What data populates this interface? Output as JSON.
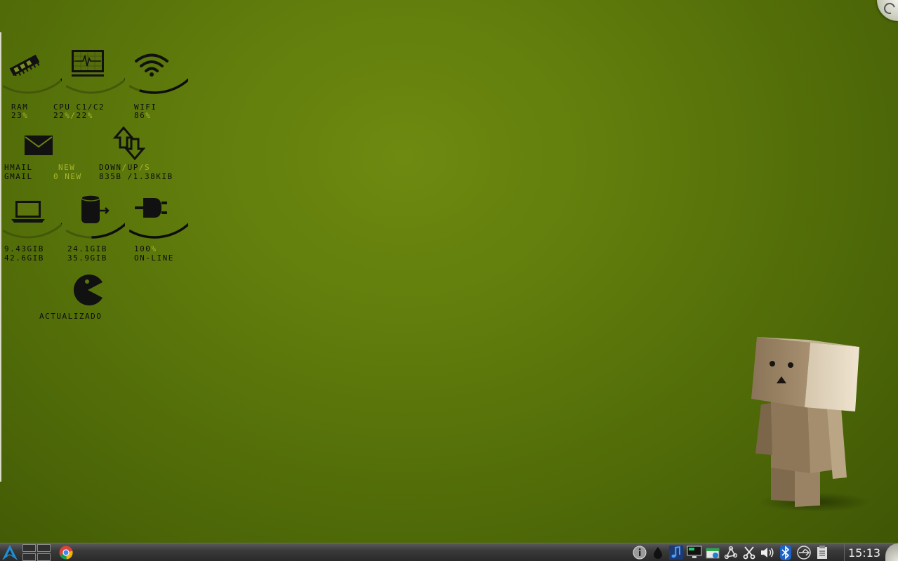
{
  "widgets": {
    "ram": {
      "label": "RAM",
      "value": "23",
      "unit": "%",
      "level": 0.23
    },
    "cpu": {
      "label": "CPU C1/C2",
      "v1": "22",
      "unit1": "%",
      "sep": "/",
      "v2": "22",
      "unit2": "%",
      "level": 0.22
    },
    "wifi": {
      "label": "WIFI",
      "value": "86",
      "unit": "%",
      "level": 0.86
    },
    "mail": {
      "row1_name": "HMAIL",
      "row1_status": "NEW",
      "row2_name": "GMAIL",
      "row2_status": "0 NEW"
    },
    "net": {
      "label_down": "DOWN",
      "sep": "/",
      "label_up": "UP",
      "label_unit": "/S",
      "down": "835B",
      "up": "/1.38KIB"
    },
    "disk1": {
      "used": "9.43GIB",
      "total": "42.6GIB",
      "level": 0.22
    },
    "disk2": {
      "used": "24.1GIB",
      "total": "35.9GIB",
      "level": 0.67
    },
    "power": {
      "value": "100",
      "unit": "%",
      "status": "ON-LINE",
      "level": 1.0
    },
    "updates": {
      "status": "ACTUALIZADO"
    }
  },
  "icons": {
    "ram": "ram-chip-icon",
    "cpu": "cpu-monitor-icon",
    "wifi": "wifi-icon",
    "mail": "mail-envelope-icon",
    "net": "up-down-arrows-icon",
    "laptop": "laptop-icon",
    "disk": "disk-drive-icon",
    "power": "power-plug-icon",
    "updates": "pacman-icon"
  },
  "taskbar": {
    "clock": "15:13",
    "tray_icons": [
      "info-icon",
      "drop-icon",
      "music-note-icon",
      "monitor-icon",
      "package-icon",
      "network-graph-icon",
      "scissors-icon",
      "volume-icon",
      "bluetooth-icon",
      "usb-icon",
      "clipboard-icon"
    ]
  },
  "colors": {
    "accent": "#a8b52e",
    "text": "#0c0c0c",
    "gauge_track": "#3d4d0a",
    "gauge_fill": "#0d0d0d",
    "bg_center": "#6e8a10",
    "bg_edge": "#3e5505"
  }
}
